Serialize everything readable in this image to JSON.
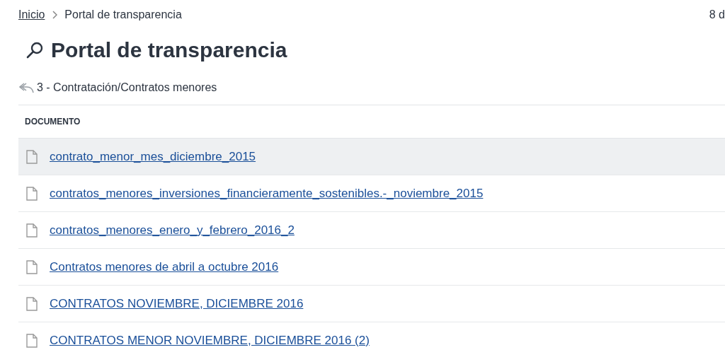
{
  "breadcrumb": {
    "items": [
      {
        "label": "Inicio",
        "kind": "link"
      },
      {
        "label": "Portal de transparencia",
        "kind": "current"
      }
    ],
    "aside": "8 d"
  },
  "title": "Portal de transparencia",
  "folder": "3 - Contratación/Contratos menores",
  "table": {
    "columns": [
      "DOCUMENTO"
    ],
    "rows": [
      {
        "name": "contrato_menor_mes_diciembre_2015",
        "selected": true
      },
      {
        "name": "contratos_menores_inversiones_financieramente_sostenibles.-_noviembre_2015",
        "selected": false
      },
      {
        "name": "contratos_menores_enero_y_febrero_2016_2",
        "selected": false
      },
      {
        "name": "Contratos menores de abril a octubre 2016",
        "selected": false
      },
      {
        "name": "CONTRATOS NOVIEMBRE, DICIEMBRE 2016",
        "selected": false
      },
      {
        "name": "CONTRATOS MENOR NOVIEMBRE, DICIEMBRE 2016 (2)",
        "selected": false
      }
    ]
  }
}
